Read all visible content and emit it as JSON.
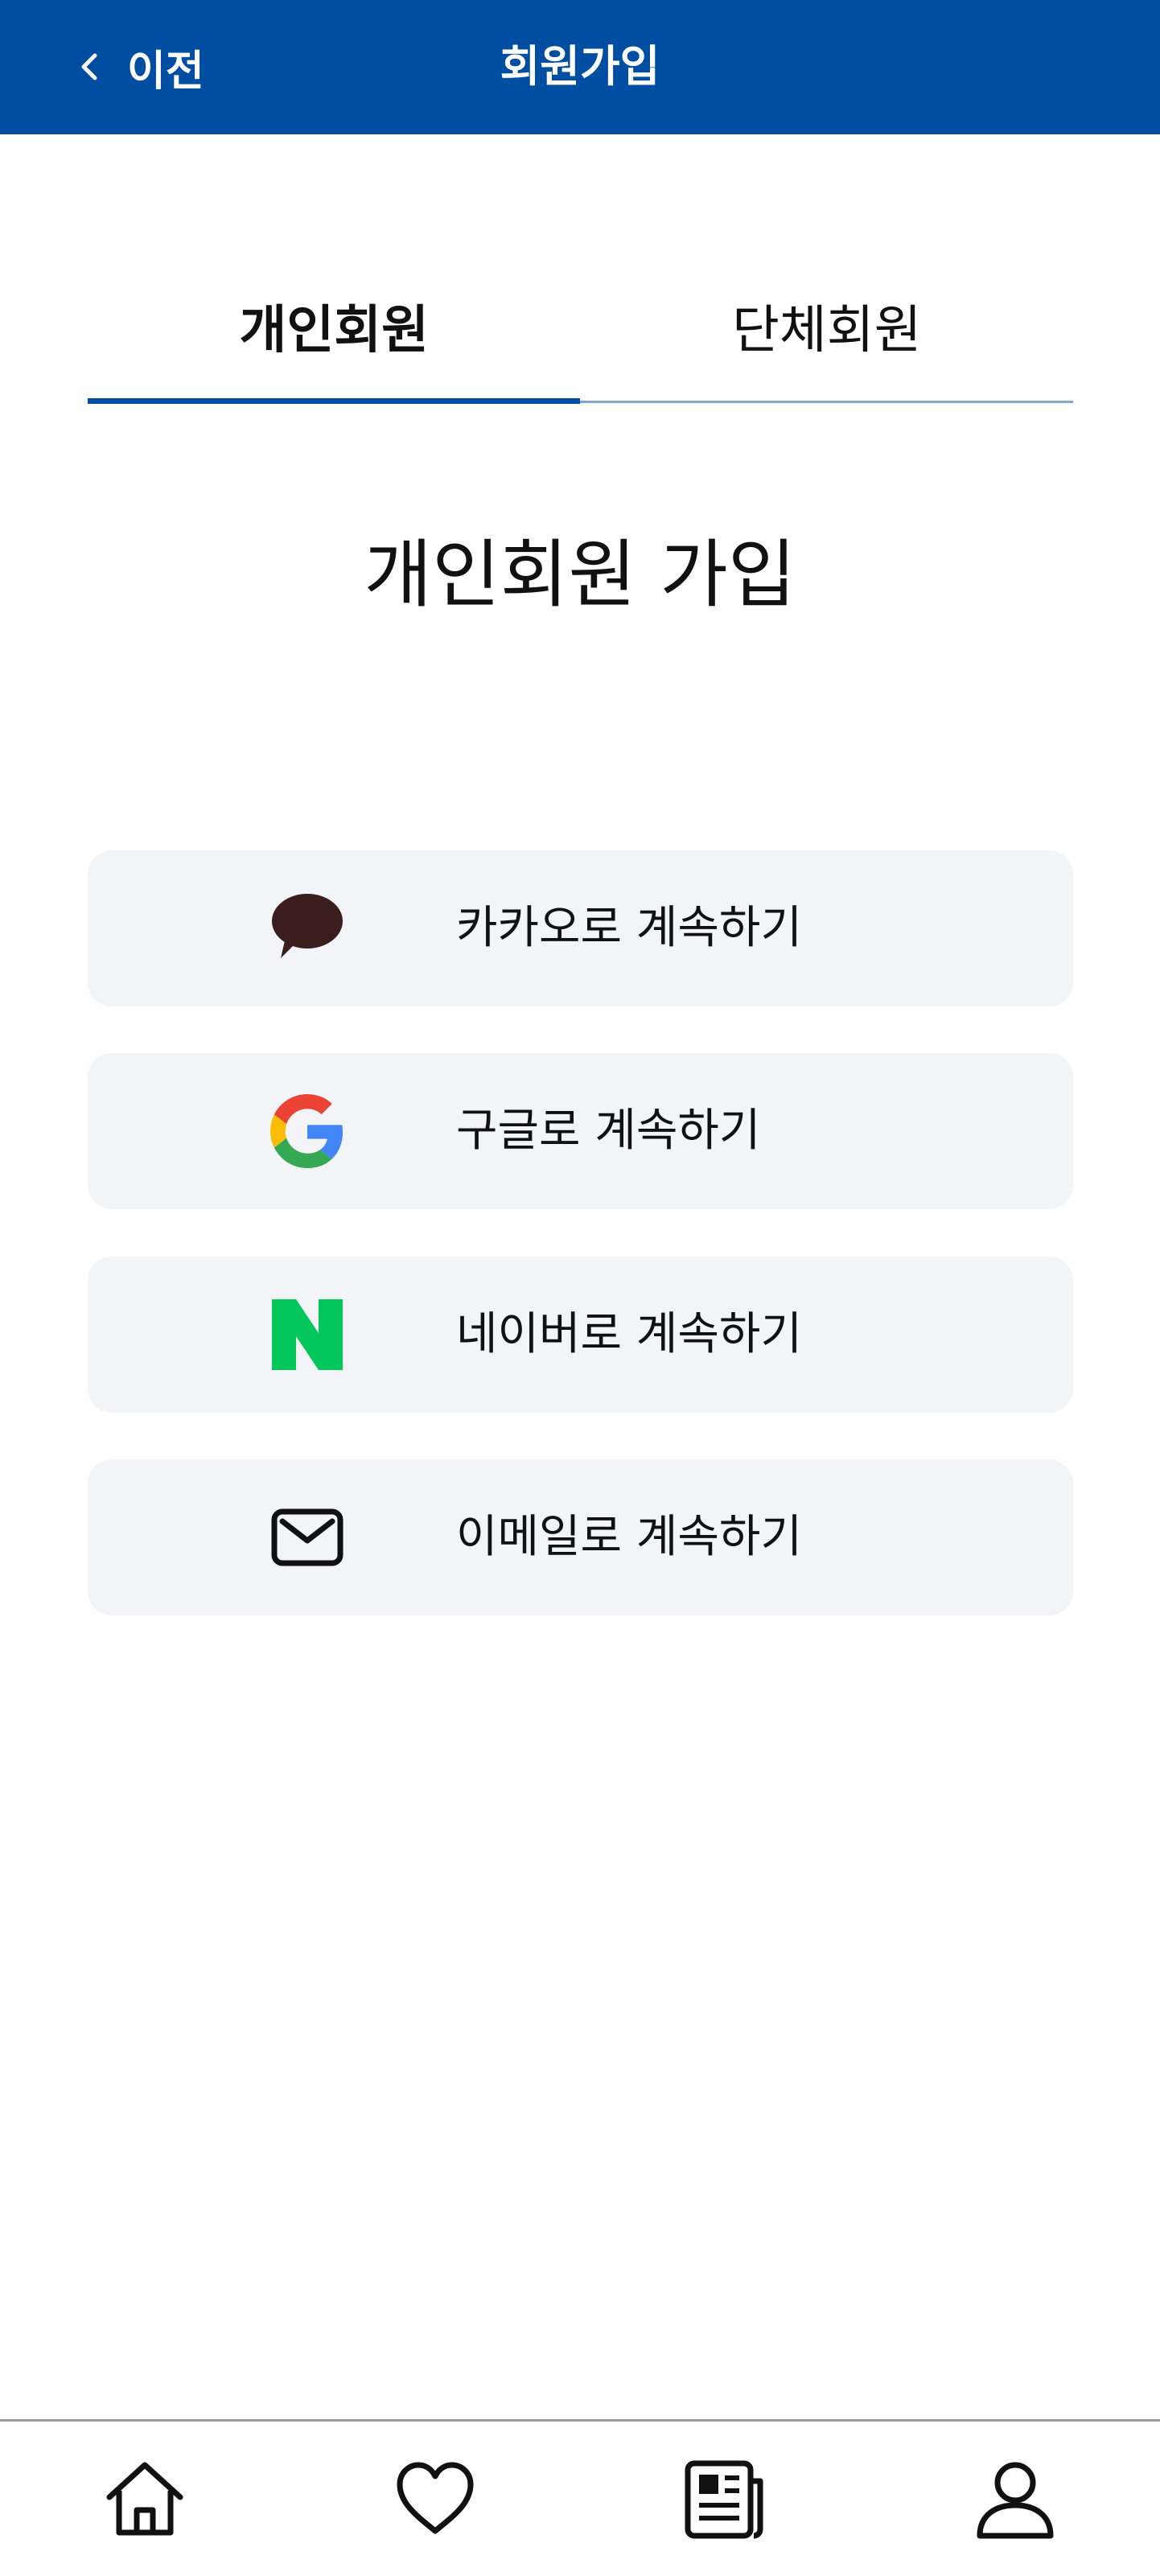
{
  "header": {
    "back_label": "이전",
    "title": "회원가입",
    "background_color": "#004ea2"
  },
  "tabs": [
    {
      "label": "개인회원",
      "active": true
    },
    {
      "label": "단체회원",
      "active": false
    }
  ],
  "section_title": "개인회원 가입",
  "login_options": [
    {
      "label": "카카오로 계속하기",
      "icon": "kakao-speech-bubble-icon"
    },
    {
      "label": "구글로 계속하기",
      "icon": "google-g-icon"
    },
    {
      "label": "네이버로 계속하기",
      "icon": "naver-n-icon"
    },
    {
      "label": "이메일로 계속하기",
      "icon": "envelope-icon"
    }
  ],
  "bottom_nav": [
    {
      "name": "home",
      "icon": "home-icon"
    },
    {
      "name": "favorites",
      "icon": "heart-icon"
    },
    {
      "name": "news",
      "icon": "newspaper-icon"
    },
    {
      "name": "profile",
      "icon": "user-icon"
    }
  ],
  "colors": {
    "brand_blue": "#004ea2",
    "button_bg": "#f2f4f7",
    "kakao": "#3a1d1d",
    "naver": "#03c75a"
  }
}
